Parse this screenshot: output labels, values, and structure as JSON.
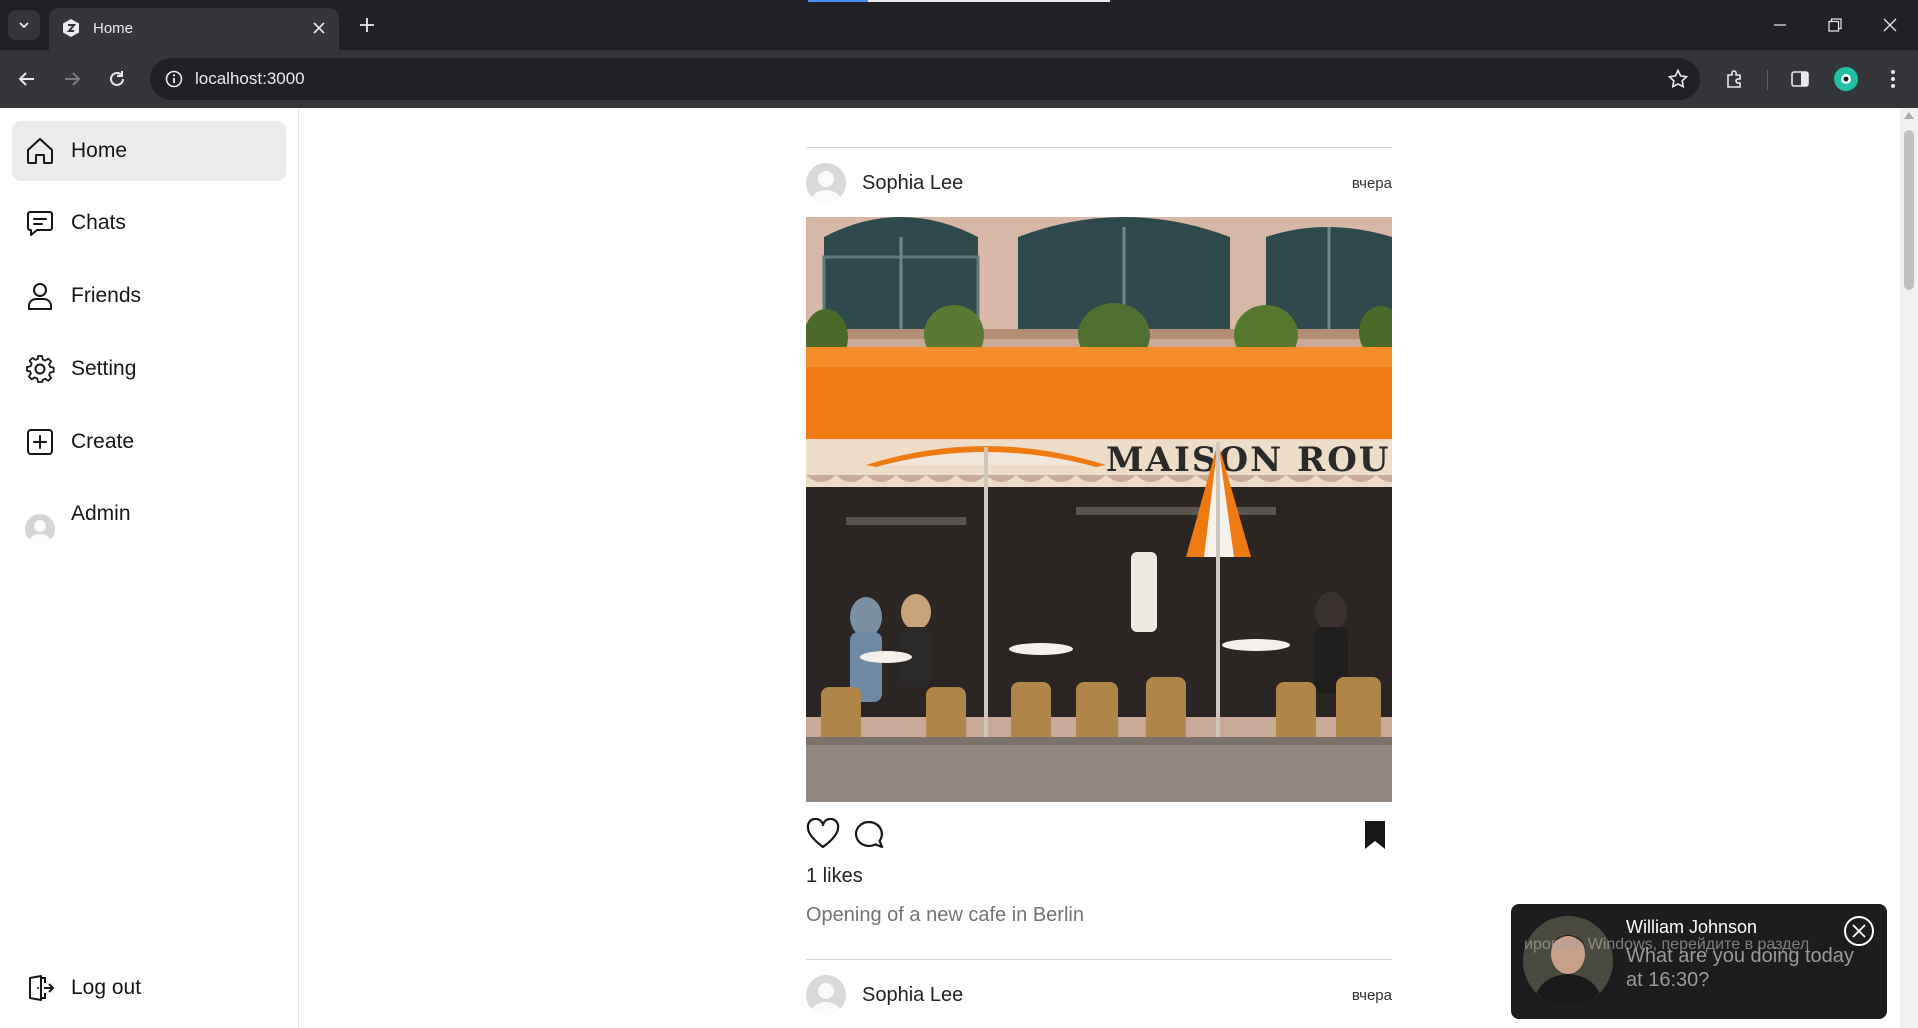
{
  "browser": {
    "tab_title": "Home",
    "url": "localhost:3000"
  },
  "sidebar": {
    "items": [
      {
        "label": "Home",
        "icon": "home-icon",
        "active": true
      },
      {
        "label": "Chats",
        "icon": "chat-icon"
      },
      {
        "label": "Friends",
        "icon": "user-icon"
      },
      {
        "label": "Setting",
        "icon": "gear-icon"
      },
      {
        "label": "Create",
        "icon": "plus-square-icon"
      },
      {
        "label": "Admin",
        "icon": "avatar-icon"
      }
    ],
    "logout_label": "Log out"
  },
  "feed": {
    "posts": [
      {
        "author": "Sophia Lee",
        "time": "вчера",
        "likes": "1 likes",
        "caption": "Opening of a new cafe in Berlin",
        "image_signage": "MAISON ROUGE"
      },
      {
        "author": "Sophia Lee",
        "time": "вчера"
      }
    ]
  },
  "toast": {
    "name": "William Johnson",
    "message": "What are you doing today at 16:30?"
  },
  "watermark": "ировать Windows, перейдите в раздел",
  "colors": {
    "chrome_dark": "#202124",
    "chrome_toolbar": "#35363a",
    "awning": "#f07a12",
    "toast_bg": "#1d1d1f",
    "active_nav": "#ececec"
  }
}
